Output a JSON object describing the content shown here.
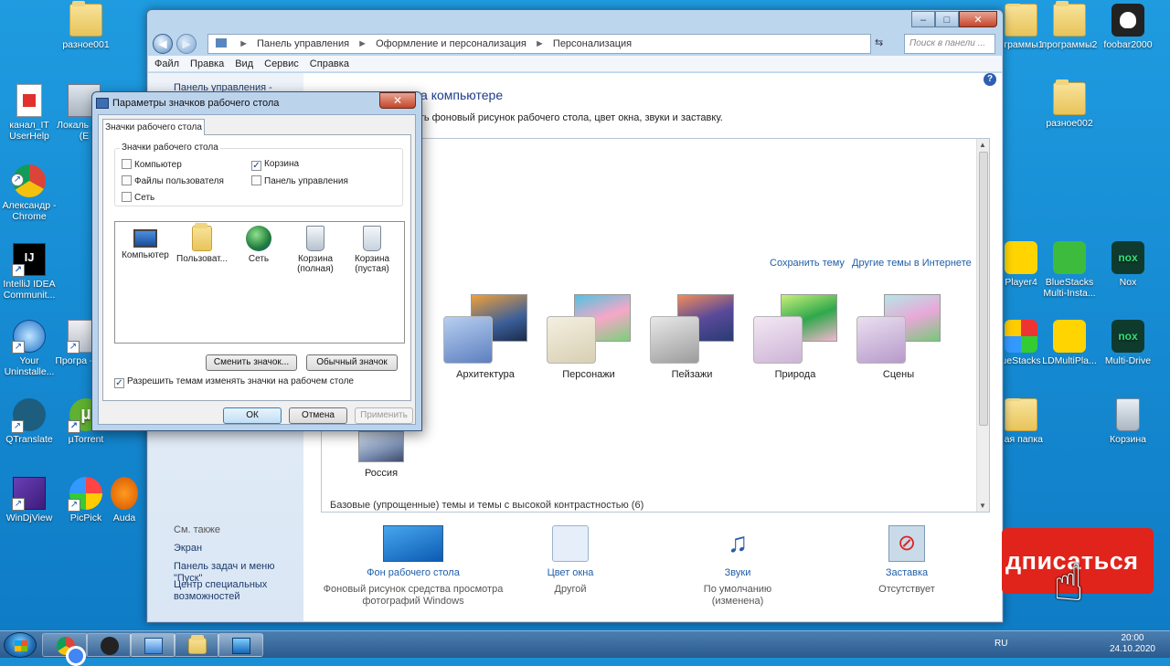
{
  "desktop": {
    "icons": [
      {
        "label": "разное001"
      },
      {
        "label": "канал_IT UserHelp"
      },
      {
        "label": "Локаль диск (E"
      },
      {
        "label": "Александр - Chrome"
      },
      {
        "label": "IntelliJ IDEA Communit..."
      },
      {
        "label": "Your Uninstalle..."
      },
      {
        "label": "Програ - Ярл"
      },
      {
        "label": "QTranslate"
      },
      {
        "label": "µTorrent"
      },
      {
        "label": "WinDjView"
      },
      {
        "label": "PicPick"
      },
      {
        "label": "Auda"
      },
      {
        "label": "ограммы1"
      },
      {
        "label": "программы2"
      },
      {
        "label": "foobar2000"
      },
      {
        "label": "разное002"
      },
      {
        "label": "Player4"
      },
      {
        "label": "BlueStacks Multi-Insta..."
      },
      {
        "label": "Nox"
      },
      {
        "label": "ueStacks"
      },
      {
        "label": "LDMultiPla..."
      },
      {
        "label": "Multi-Drive"
      },
      {
        "label": "пая папка"
      },
      {
        "label": "Корзина"
      }
    ]
  },
  "explorer": {
    "address": {
      "crumbs": [
        "Панель управления",
        "Оформление и персонализация",
        "Персонализация"
      ],
      "separator": "►",
      "search_placeholder": "Поиск в панели ..."
    },
    "menu": [
      "Файл",
      "Правка",
      "Вид",
      "Сервис",
      "Справка"
    ],
    "leftpane": {
      "top_link": "Панель управления -",
      "see_also_title": "См. также",
      "see_also": [
        "Экран",
        "Панель задач и меню \"Пуск\"",
        "Центр специальных возможностей"
      ]
    },
    "heading": "ажения и звука на компьютере",
    "subheading": "дновременно изменить фоновый рисунок рабочего стола, цвет окна, звуки и заставку.",
    "links": {
      "save_theme": "Сохранить тему",
      "other_themes": "Другие темы в Интернете"
    },
    "themes": [
      {
        "name": "Архитектура"
      },
      {
        "name": "Персонажи"
      },
      {
        "name": "Пейзажи"
      },
      {
        "name": "Природа"
      },
      {
        "name": "Сцены"
      }
    ],
    "russia_theme": "Россия",
    "basic_themes": "Базовые (упрощенные) темы и темы с высокой контрастностью (6)",
    "bottom": [
      {
        "link": "Фон рабочего стола",
        "sub": "Фоновый рисунок средства просмотра фотографий Windows"
      },
      {
        "link": "Цвет окна",
        "sub": "Другой"
      },
      {
        "link": "Звуки",
        "sub": "По умолчанию (изменена)"
      },
      {
        "link": "Заставка",
        "sub": "Отсутствует"
      }
    ]
  },
  "dialog": {
    "title": "Параметры значков рабочего стола",
    "tab": "Значки рабочего стола",
    "group": "Значки рабочего стола",
    "checkboxes": [
      {
        "label": "Компьютер",
        "checked": false
      },
      {
        "label": "Корзина",
        "checked": true
      },
      {
        "label": "Файлы пользователя",
        "checked": false
      },
      {
        "label": "Панель управления",
        "checked": false
      },
      {
        "label": "Сеть",
        "checked": false
      }
    ],
    "icons": [
      {
        "label": "Компьютер"
      },
      {
        "label": "Пользоват..."
      },
      {
        "label": "Сеть"
      },
      {
        "label": "Корзина (полная)"
      },
      {
        "label": "Корзина (пустая)"
      }
    ],
    "change_icon": "Сменить значок...",
    "default_icon": "Обычный значок",
    "allow_themes": "Разрешить темам изменять значки на рабочем столе",
    "allow_themes_checked": true,
    "ok": "ОК",
    "cancel": "Отмена",
    "apply": "Применить"
  },
  "promo": {
    "text": "дписаться"
  },
  "taskbar": {
    "lang": "RU",
    "time": "20:00",
    "date": "24.10.2020"
  }
}
